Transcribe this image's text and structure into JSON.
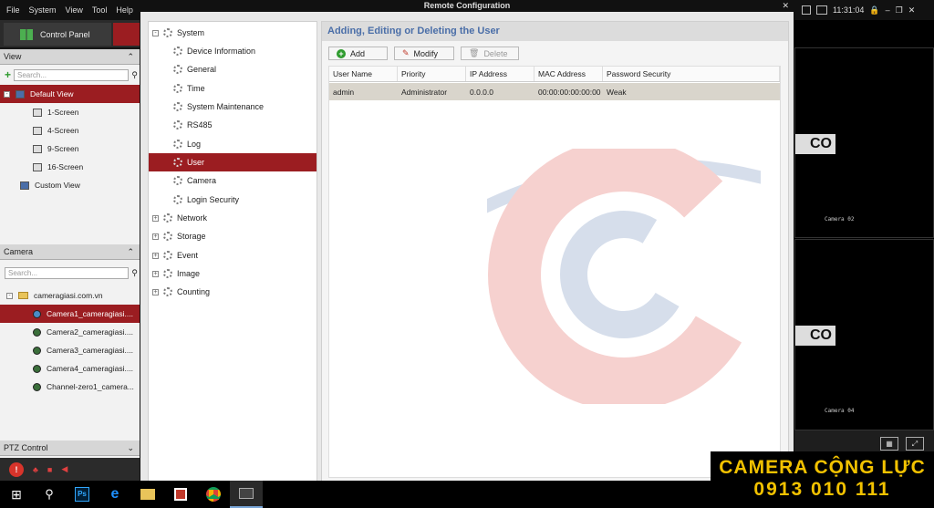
{
  "app": {
    "menu": [
      "File",
      "System",
      "View",
      "Tool",
      "Help"
    ],
    "control_panel_label": "Control Panel"
  },
  "view_panel": {
    "header": "View",
    "search_placeholder": "Search...",
    "items": [
      {
        "label": "Default View"
      },
      {
        "label": "1-Screen"
      },
      {
        "label": "4-Screen"
      },
      {
        "label": "9-Screen"
      },
      {
        "label": "16-Screen"
      },
      {
        "label": "Custom View"
      }
    ]
  },
  "camera_panel": {
    "header": "Camera",
    "search_placeholder": "Search...",
    "root": "cameragiasi.com.vn",
    "items": [
      {
        "label": "Camera1_cameragiasi...."
      },
      {
        "label": "Camera2_cameragiasi...."
      },
      {
        "label": "Camera3_cameragiasi...."
      },
      {
        "label": "Camera4_cameragiasi...."
      },
      {
        "label": "Channel-zero1_camera..."
      }
    ]
  },
  "ptz_panel": {
    "header": "PTZ Control"
  },
  "dialog": {
    "title": "Remote Configuration",
    "nav": {
      "system": "System",
      "system_children": [
        "Device Information",
        "General",
        "Time",
        "System Maintenance",
        "RS485",
        "Log",
        "User",
        "Camera",
        "Login Security"
      ],
      "groups": [
        "Network",
        "Storage",
        "Event",
        "Image",
        "Counting"
      ]
    },
    "content_title": "Adding, Editing or Deleting the User",
    "buttons": {
      "add": "Add",
      "modify": "Modify",
      "delete": "Delete"
    },
    "table": {
      "columns": [
        "User Name",
        "Priority",
        "IP Address",
        "MAC Address",
        "Password Security"
      ],
      "rows": [
        [
          "admin",
          "Administrator",
          "0.0.0.0",
          "00:00:00:00:00:00",
          "Weak"
        ]
      ]
    }
  },
  "right_panel": {
    "clock": "11:31:04",
    "camera_02_label": "Camera 02",
    "camera_04_label": "Camera 04",
    "logo_fragment": "CO"
  },
  "promo": {
    "line1": "CAMERA CỘNG LỰC",
    "line2": "0913 010 111"
  },
  "colors": {
    "accent_red": "#9b1d21",
    "title_blue": "#4a6ea8",
    "promo_yellow": "#f2c200"
  }
}
